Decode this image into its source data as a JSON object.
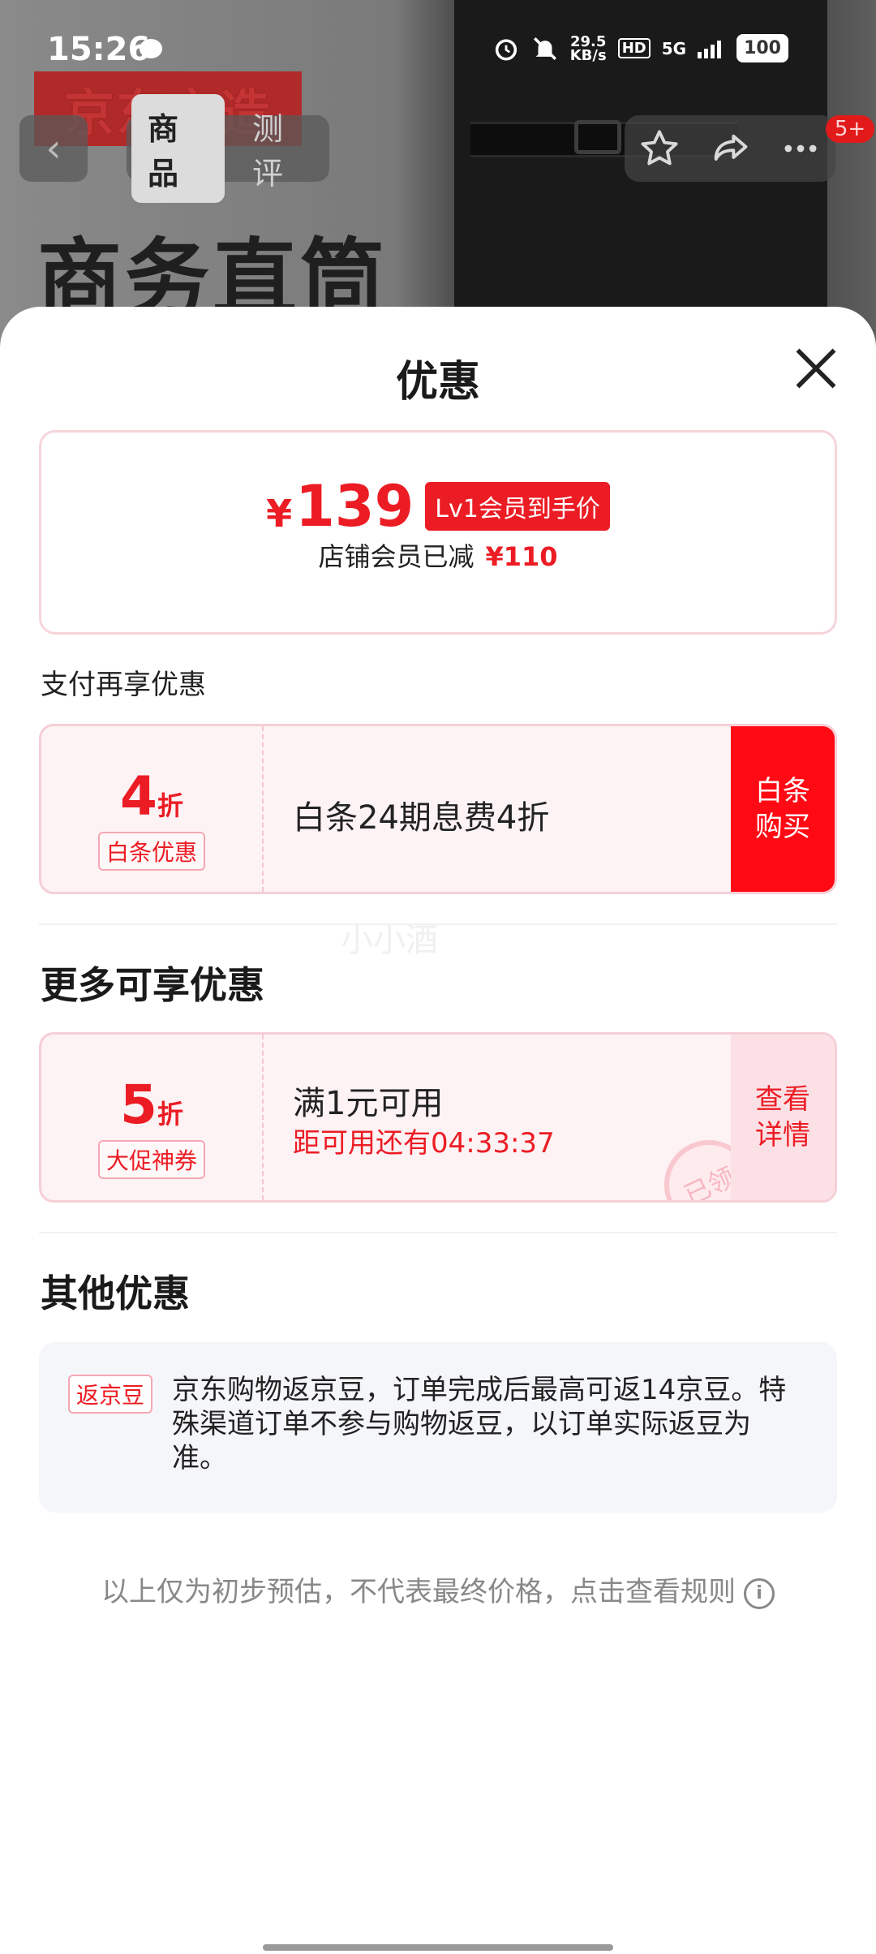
{
  "status_bar": {
    "time": "15:26",
    "net_speed_value": "29.5",
    "net_speed_unit": "KB/s",
    "hd": "HD",
    "network": "5G",
    "battery": "100"
  },
  "background": {
    "brand": "京东京造",
    "product_title": "商务直筒"
  },
  "nav": {
    "tabs": [
      "商品",
      "测评"
    ],
    "active_tab": 0,
    "badge": "5+"
  },
  "sheet": {
    "title": "优惠",
    "price": {
      "symbol": "¥",
      "value": "139",
      "tag": "Lv1会员到手价",
      "sub_label": "店铺会员已减",
      "sub_amount": "¥110"
    },
    "payment_section_label": "支付再享优惠",
    "payment_coupon": {
      "discount_num": "4",
      "discount_unit": "折",
      "tag": "白条优惠",
      "description": "白条24期息费4折",
      "action": "白条\n购买"
    },
    "watermark": "小小酒",
    "more_section_title": "更多可享优惠",
    "more_coupon": {
      "discount_num": "5",
      "discount_unit": "折",
      "tag": "大促神券",
      "description": "满1元可用",
      "countdown": "距可用还有04:33:37",
      "action": "查看\n详情",
      "stamp": "已领"
    },
    "other_section_title": "其他优惠",
    "other": {
      "tag": "返京豆",
      "text": "京东购物返京豆，订单完成后最高可返14京豆。特殊渠道订单不参与购物返豆，以订单实际返豆为准。"
    },
    "footnote": "以上仅为初步预估，不代表最终价格，点击查看规则"
  },
  "colors": {
    "accent": "#ec1c24",
    "coupon_bg": "#fdf2f4",
    "other_bg": "#f5f6fa"
  }
}
